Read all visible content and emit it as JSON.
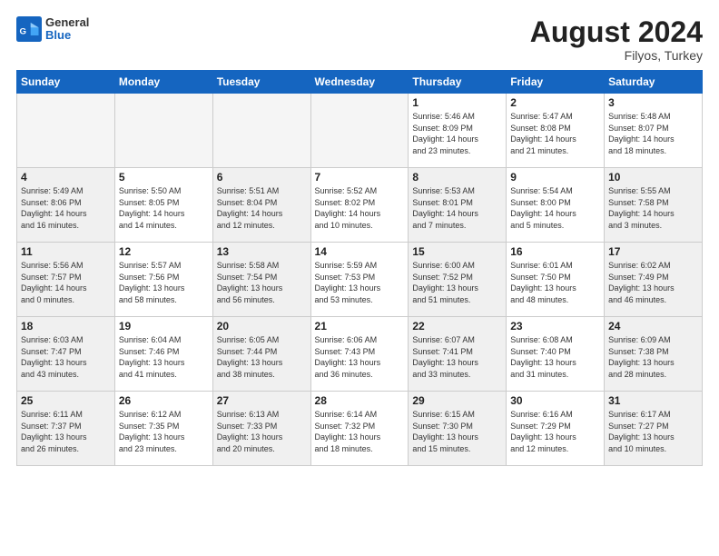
{
  "logo": {
    "general": "General",
    "blue": "Blue"
  },
  "header": {
    "month_year": "August 2024",
    "location": "Filyos, Turkey"
  },
  "weekdays": [
    "Sunday",
    "Monday",
    "Tuesday",
    "Wednesday",
    "Thursday",
    "Friday",
    "Saturday"
  ],
  "weeks": [
    [
      {
        "day": "",
        "info": "",
        "empty": true
      },
      {
        "day": "",
        "info": "",
        "empty": true
      },
      {
        "day": "",
        "info": "",
        "empty": true
      },
      {
        "day": "",
        "info": "",
        "empty": true
      },
      {
        "day": "1",
        "info": "Sunrise: 5:46 AM\nSunset: 8:09 PM\nDaylight: 14 hours\nand 23 minutes."
      },
      {
        "day": "2",
        "info": "Sunrise: 5:47 AM\nSunset: 8:08 PM\nDaylight: 14 hours\nand 21 minutes."
      },
      {
        "day": "3",
        "info": "Sunrise: 5:48 AM\nSunset: 8:07 PM\nDaylight: 14 hours\nand 18 minutes."
      }
    ],
    [
      {
        "day": "4",
        "info": "Sunrise: 5:49 AM\nSunset: 8:06 PM\nDaylight: 14 hours\nand 16 minutes.",
        "shaded": true
      },
      {
        "day": "5",
        "info": "Sunrise: 5:50 AM\nSunset: 8:05 PM\nDaylight: 14 hours\nand 14 minutes."
      },
      {
        "day": "6",
        "info": "Sunrise: 5:51 AM\nSunset: 8:04 PM\nDaylight: 14 hours\nand 12 minutes.",
        "shaded": true
      },
      {
        "day": "7",
        "info": "Sunrise: 5:52 AM\nSunset: 8:02 PM\nDaylight: 14 hours\nand 10 minutes."
      },
      {
        "day": "8",
        "info": "Sunrise: 5:53 AM\nSunset: 8:01 PM\nDaylight: 14 hours\nand 7 minutes.",
        "shaded": true
      },
      {
        "day": "9",
        "info": "Sunrise: 5:54 AM\nSunset: 8:00 PM\nDaylight: 14 hours\nand 5 minutes."
      },
      {
        "day": "10",
        "info": "Sunrise: 5:55 AM\nSunset: 7:58 PM\nDaylight: 14 hours\nand 3 minutes.",
        "shaded": true
      }
    ],
    [
      {
        "day": "11",
        "info": "Sunrise: 5:56 AM\nSunset: 7:57 PM\nDaylight: 14 hours\nand 0 minutes.",
        "shaded": true
      },
      {
        "day": "12",
        "info": "Sunrise: 5:57 AM\nSunset: 7:56 PM\nDaylight: 13 hours\nand 58 minutes."
      },
      {
        "day": "13",
        "info": "Sunrise: 5:58 AM\nSunset: 7:54 PM\nDaylight: 13 hours\nand 56 minutes.",
        "shaded": true
      },
      {
        "day": "14",
        "info": "Sunrise: 5:59 AM\nSunset: 7:53 PM\nDaylight: 13 hours\nand 53 minutes."
      },
      {
        "day": "15",
        "info": "Sunrise: 6:00 AM\nSunset: 7:52 PM\nDaylight: 13 hours\nand 51 minutes.",
        "shaded": true
      },
      {
        "day": "16",
        "info": "Sunrise: 6:01 AM\nSunset: 7:50 PM\nDaylight: 13 hours\nand 48 minutes."
      },
      {
        "day": "17",
        "info": "Sunrise: 6:02 AM\nSunset: 7:49 PM\nDaylight: 13 hours\nand 46 minutes.",
        "shaded": true
      }
    ],
    [
      {
        "day": "18",
        "info": "Sunrise: 6:03 AM\nSunset: 7:47 PM\nDaylight: 13 hours\nand 43 minutes.",
        "shaded": true
      },
      {
        "day": "19",
        "info": "Sunrise: 6:04 AM\nSunset: 7:46 PM\nDaylight: 13 hours\nand 41 minutes."
      },
      {
        "day": "20",
        "info": "Sunrise: 6:05 AM\nSunset: 7:44 PM\nDaylight: 13 hours\nand 38 minutes.",
        "shaded": true
      },
      {
        "day": "21",
        "info": "Sunrise: 6:06 AM\nSunset: 7:43 PM\nDaylight: 13 hours\nand 36 minutes."
      },
      {
        "day": "22",
        "info": "Sunrise: 6:07 AM\nSunset: 7:41 PM\nDaylight: 13 hours\nand 33 minutes.",
        "shaded": true
      },
      {
        "day": "23",
        "info": "Sunrise: 6:08 AM\nSunset: 7:40 PM\nDaylight: 13 hours\nand 31 minutes."
      },
      {
        "day": "24",
        "info": "Sunrise: 6:09 AM\nSunset: 7:38 PM\nDaylight: 13 hours\nand 28 minutes.",
        "shaded": true
      }
    ],
    [
      {
        "day": "25",
        "info": "Sunrise: 6:11 AM\nSunset: 7:37 PM\nDaylight: 13 hours\nand 26 minutes.",
        "shaded": true
      },
      {
        "day": "26",
        "info": "Sunrise: 6:12 AM\nSunset: 7:35 PM\nDaylight: 13 hours\nand 23 minutes."
      },
      {
        "day": "27",
        "info": "Sunrise: 6:13 AM\nSunset: 7:33 PM\nDaylight: 13 hours\nand 20 minutes.",
        "shaded": true
      },
      {
        "day": "28",
        "info": "Sunrise: 6:14 AM\nSunset: 7:32 PM\nDaylight: 13 hours\nand 18 minutes."
      },
      {
        "day": "29",
        "info": "Sunrise: 6:15 AM\nSunset: 7:30 PM\nDaylight: 13 hours\nand 15 minutes.",
        "shaded": true
      },
      {
        "day": "30",
        "info": "Sunrise: 6:16 AM\nSunset: 7:29 PM\nDaylight: 13 hours\nand 12 minutes."
      },
      {
        "day": "31",
        "info": "Sunrise: 6:17 AM\nSunset: 7:27 PM\nDaylight: 13 hours\nand 10 minutes.",
        "shaded": true
      }
    ]
  ]
}
